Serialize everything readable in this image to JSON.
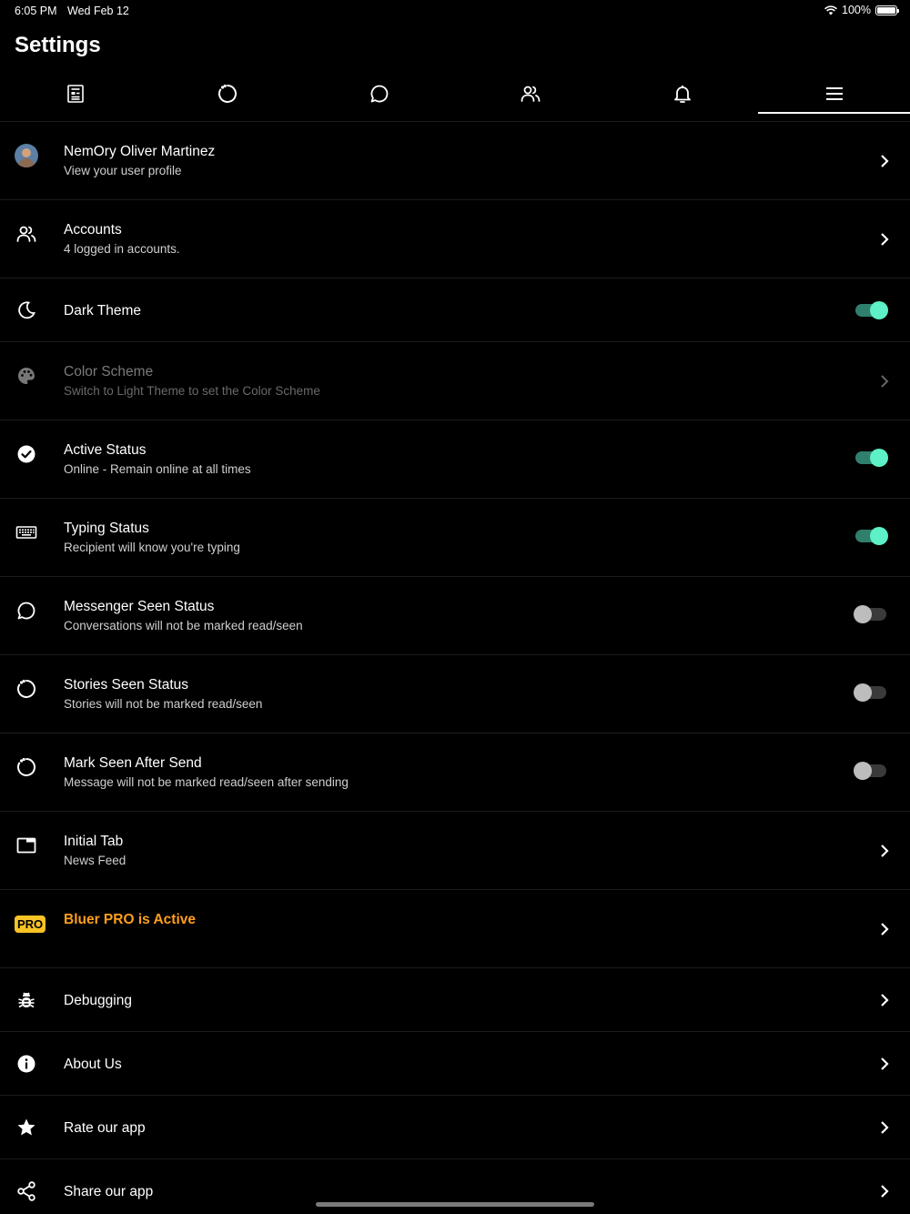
{
  "status_bar": {
    "time": "6:05 PM",
    "date": "Wed Feb 12",
    "battery": "100%"
  },
  "page": {
    "title": "Settings"
  },
  "tabs": [
    {
      "icon": "news-feed-icon",
      "active": false
    },
    {
      "icon": "stories-icon",
      "active": false
    },
    {
      "icon": "messenger-icon",
      "active": false
    },
    {
      "icon": "friends-icon",
      "active": false
    },
    {
      "icon": "notifications-icon",
      "active": false
    },
    {
      "icon": "menu-icon",
      "active": true
    }
  ],
  "settings": {
    "profile": {
      "title": "NemOry Oliver Martinez",
      "subtitle": "View your user profile"
    },
    "accounts": {
      "title": "Accounts",
      "subtitle": "4 logged in accounts."
    },
    "dark_theme": {
      "title": "Dark Theme",
      "enabled": true
    },
    "color_scheme": {
      "title": "Color Scheme",
      "subtitle": "Switch to Light Theme to set the Color Scheme"
    },
    "active_status": {
      "title": "Active Status",
      "subtitle": "Online - Remain online at all times",
      "enabled": true
    },
    "typing_status": {
      "title": "Typing Status",
      "subtitle": "Recipient will know you're typing",
      "enabled": true
    },
    "messenger_seen": {
      "title": "Messenger Seen Status",
      "subtitle": "Conversations will not be marked read/seen",
      "enabled": false
    },
    "stories_seen": {
      "title": "Stories Seen Status",
      "subtitle": "Stories will not be marked read/seen",
      "enabled": false
    },
    "mark_seen_after_send": {
      "title": "Mark Seen After Send",
      "subtitle": "Message will not be marked read/seen after sending",
      "enabled": false
    },
    "initial_tab": {
      "title": "Initial Tab",
      "subtitle": "News Feed"
    },
    "pro": {
      "badge": "PRO",
      "title": "Bluer PRO is Active"
    },
    "debugging": {
      "title": "Debugging"
    },
    "about": {
      "title": "About Us"
    },
    "rate": {
      "title": "Rate our app"
    },
    "share": {
      "title": "Share our app"
    }
  },
  "colors": {
    "background": "#000000",
    "toggle_on_knob": "#5ef0c6",
    "toggle_on_track": "#2f7f6c",
    "pro_text": "#ff9f1c",
    "pro_badge": "#f7c325"
  }
}
